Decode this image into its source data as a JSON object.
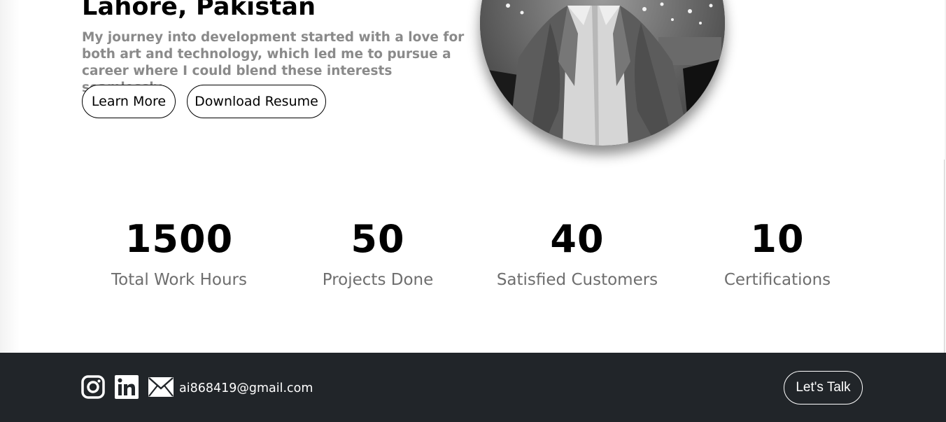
{
  "hero": {
    "title": "Lahore, Pakistan",
    "description": "My journey into development started with a love for both art and technology, which led me to pursue a career where I could blend these interests seamlessly.",
    "learn_more_label": "Learn More",
    "download_resume_label": "Download Resume"
  },
  "stats": [
    {
      "value": "1500",
      "label": "Total Work Hours"
    },
    {
      "value": "50",
      "label": "Projects Done"
    },
    {
      "value": "40",
      "label": "Satisfied Customers"
    },
    {
      "value": "10",
      "label": "Certifications"
    }
  ],
  "footer": {
    "email": "ai868419@gmail.com",
    "cta_label": "Let's Talk",
    "icons": [
      "instagram-icon",
      "linkedin-icon",
      "mail-icon"
    ]
  },
  "colors": {
    "footer_bg": "#212529",
    "muted_text": "#8a8a8a",
    "stat_label": "#6e6e6e"
  }
}
